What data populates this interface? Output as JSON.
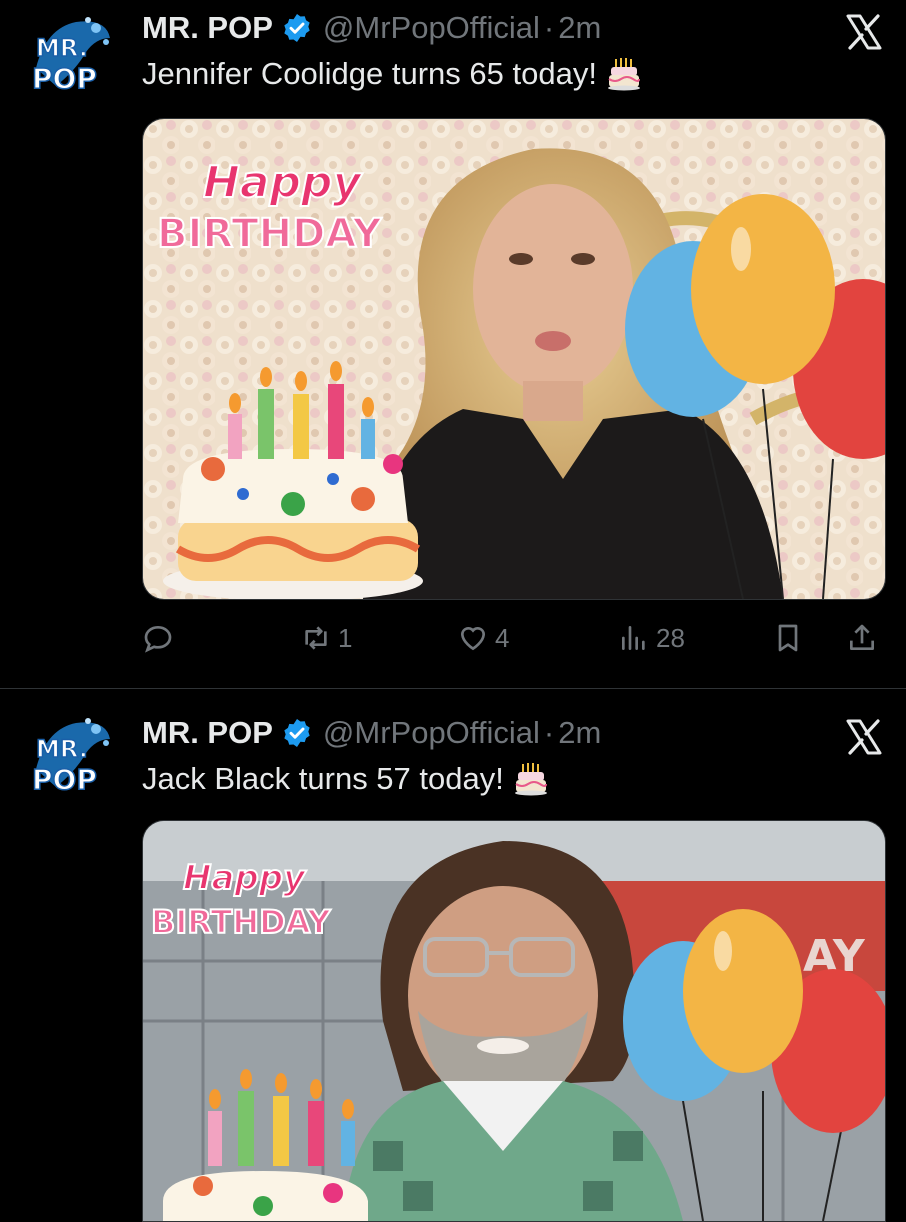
{
  "tweets": [
    {
      "author_name": "MR. POP",
      "handle": "@MrPopOfficial",
      "separator": "·",
      "time": "2m",
      "text": "Jennifer Coolidge turns 65 today!",
      "emoji": "birthday-cake-icon",
      "image": {
        "happy_text": "Happy",
        "birthday_text": "BIRTHDAY"
      },
      "stats": {
        "reposts": "1",
        "likes": "4",
        "views": "28"
      }
    },
    {
      "author_name": "MR. POP",
      "handle": "@MrPopOfficial",
      "separator": "·",
      "time": "2m",
      "text": "Jack Black turns 57 today!",
      "emoji": "birthday-cake-icon",
      "image": {
        "happy_text": "Happy",
        "birthday_text": "BIRTHDAY",
        "backdrop_text": "AY"
      }
    }
  ],
  "avatar": {
    "line1": "MR.",
    "line2": "POP"
  },
  "colors": {
    "background": "#000000",
    "text": "#e7e9ea",
    "secondary": "#71767b",
    "verified": "#1d9bf0",
    "happy_pink": "#e8356f",
    "birthday_pink": "#f06a9a"
  }
}
